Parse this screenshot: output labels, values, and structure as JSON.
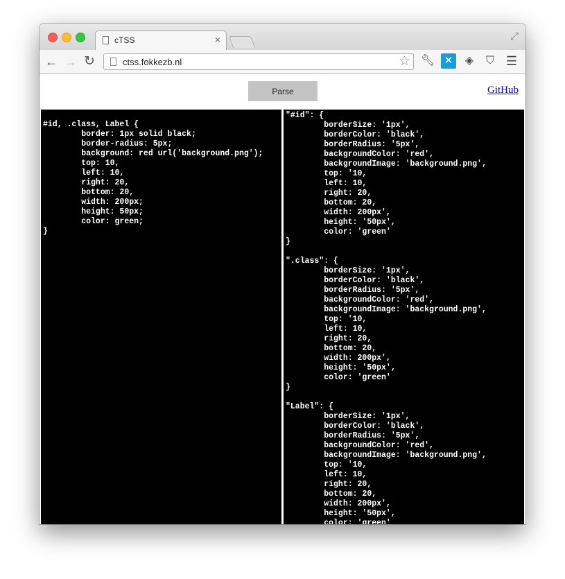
{
  "browser": {
    "tab_title": "cTSS",
    "url": "ctss.fokkezb.nl",
    "tab_close": "×"
  },
  "page": {
    "parse_label": "Parse",
    "github_label": "GitHub"
  },
  "editor": {
    "input_text": "#id, .class, Label {\n\tborder: 1px solid black;\n\tborder-radius: 5px;\n\tbackground: red url('background.png');\n\ttop: 10,\n\tleft: 10,\n\tright: 20,\n\tbottom: 20,\n\twidth: 200px;\n\theight: 50px;\n\tcolor: green;\n}",
    "output_text": "\"#id\": {\n\tborderSize: '1px',\n\tborderColor: 'black',\n\tborderRadius: '5px',\n\tbackgroundColor: 'red',\n\tbackgroundImage: 'background.png',\n\ttop: '10,\n\tleft: 10,\n\tright: 20,\n\tbottom: 20,\n\twidth: 200px',\n\theight: '50px',\n\tcolor: 'green'\n}\n\n\".class\": {\n\tborderSize: '1px',\n\tborderColor: 'black',\n\tborderRadius: '5px',\n\tbackgroundColor: 'red',\n\tbackgroundImage: 'background.png',\n\ttop: '10,\n\tleft: 10,\n\tright: 20,\n\tbottom: 20,\n\twidth: 200px',\n\theight: '50px',\n\tcolor: 'green'\n}\n\n\"Label\": {\n\tborderSize: '1px',\n\tborderColor: 'black',\n\tborderRadius: '5px',\n\tbackgroundColor: 'red',\n\tbackgroundImage: 'background.png',\n\ttop: '10,\n\tleft: 10,\n\tright: 20,\n\tbottom: 20,\n\twidth: 200px',\n\theight: '50px',\n\tcolor: 'green'\n}"
  },
  "icons": {
    "back": "arrow-left-icon",
    "forward": "arrow-right-icon",
    "reload": "reload-icon",
    "bookmark": "star-icon",
    "extensions": [
      "wrench-icon",
      "blue-extension-icon",
      "layers-icon",
      "pocket-icon",
      "menu-icon"
    ]
  },
  "colors": {
    "pane_background": "#000000",
    "pane_text": "#ffffff",
    "parse_button": "#c4c4c4",
    "link": "#0000ee"
  }
}
